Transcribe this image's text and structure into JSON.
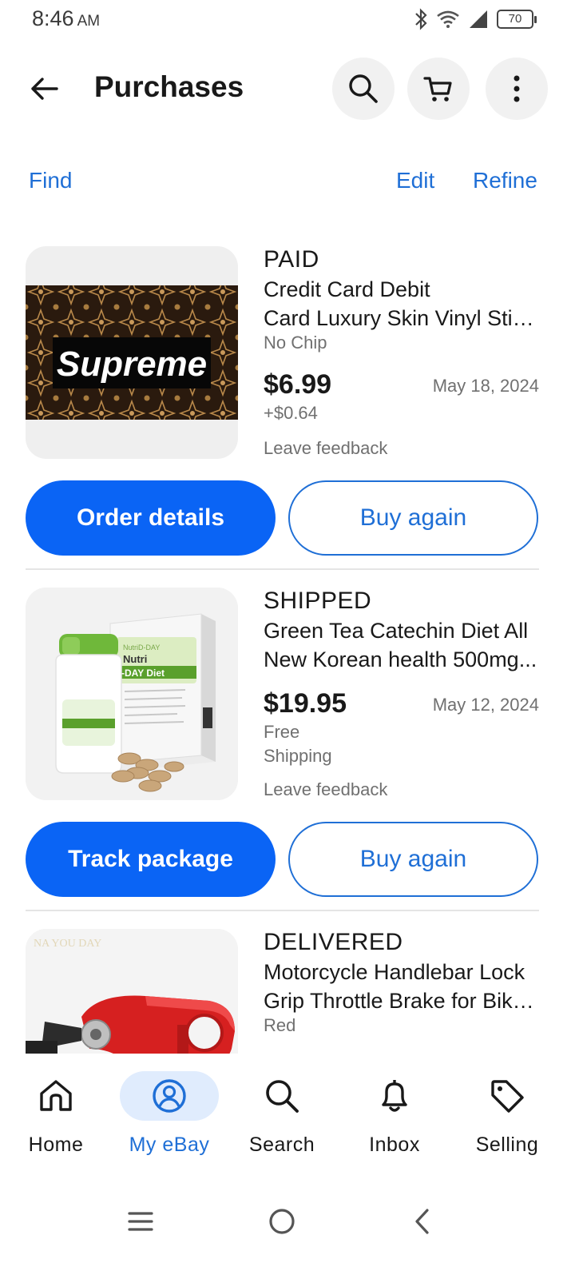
{
  "status_bar": {
    "time": "8:46",
    "ampm": "AM",
    "battery": "70"
  },
  "header": {
    "title": "Purchases"
  },
  "actions": {
    "find": "Find",
    "edit": "Edit",
    "refine": "Refine"
  },
  "purchases": [
    {
      "status": "PAID",
      "title_line1": "Credit Card  Debit",
      "title_line2": "Card Luxury Skin Vinyl Stic...",
      "variant": "No Chip",
      "price": "$6.99",
      "shipping_line1": "+$0.64",
      "date": "May 18, 2024",
      "feedback": "Leave feedback",
      "image_text": "Supreme",
      "primary_button": "Order details",
      "secondary_button": "Buy again"
    },
    {
      "status": "SHIPPED",
      "title_line1": "Green Tea Catechin Diet All",
      "title_line2": "New Korean health 500mg...",
      "price": "$19.95",
      "shipping_line1": "Free",
      "shipping_line2": "Shipping",
      "date": "May 12, 2024",
      "feedback": "Leave feedback",
      "image_text_brand": "Nutri",
      "image_text_product": "-DAY Diet",
      "primary_button": "Track package",
      "secondary_button": "Buy again"
    },
    {
      "status": "DELIVERED",
      "title_line1": "Motorcycle Handlebar Lock",
      "title_line2": "Grip Throttle Brake for Bike...",
      "variant": "Red"
    }
  ],
  "bottom_nav": [
    {
      "label": "Home",
      "icon": "home-icon"
    },
    {
      "label": "My eBay",
      "icon": "profile-icon",
      "active": true
    },
    {
      "label": "Search",
      "icon": "search-icon"
    },
    {
      "label": "Inbox",
      "icon": "bell-icon"
    },
    {
      "label": "Selling",
      "icon": "tag-icon"
    }
  ],
  "colors": {
    "accent": "#0a64f5",
    "link": "#1f6fd6",
    "muted": "#707070"
  }
}
